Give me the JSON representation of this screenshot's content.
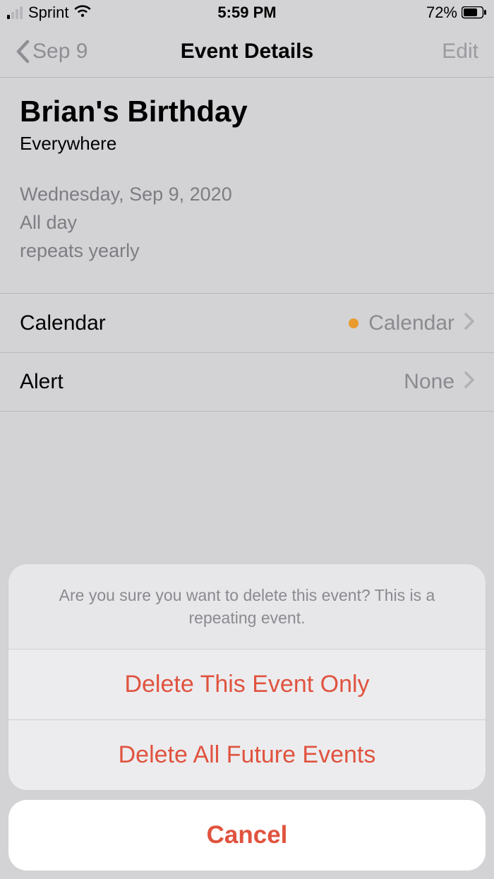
{
  "status": {
    "carrier": "Sprint",
    "time": "5:59 PM",
    "battery_pct": "72%"
  },
  "nav": {
    "back_label": "Sep 9",
    "title": "Event Details",
    "edit_label": "Edit"
  },
  "event": {
    "title": "Brian's Birthday",
    "location": "Everywhere",
    "date": "Wednesday, Sep 9, 2020",
    "time": "All day",
    "repeat": "repeats yearly"
  },
  "rows": {
    "calendar": {
      "label": "Calendar",
      "value": "Calendar",
      "dot_color": "#e99b2e"
    },
    "alert": {
      "label": "Alert",
      "value": "None"
    }
  },
  "sheet": {
    "message": "Are you sure you want to delete this event? This is a repeating event.",
    "delete_this": "Delete This Event Only",
    "delete_future": "Delete All Future Events",
    "cancel": "Cancel"
  },
  "colors": {
    "destructive": "#e0533e",
    "calendar_dot": "#e99b2e"
  }
}
